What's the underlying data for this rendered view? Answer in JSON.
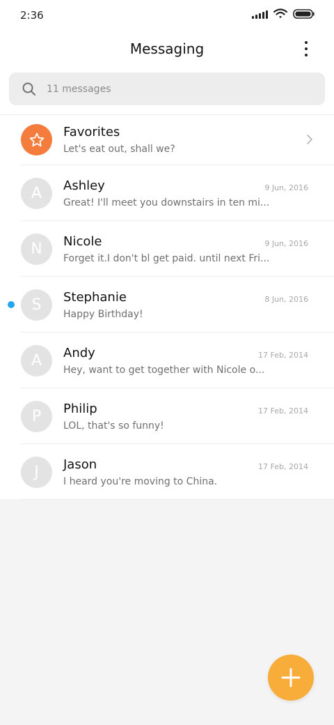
{
  "status_bar": {
    "time": "2:36",
    "icons": [
      "signal-icon",
      "wifi-icon",
      "battery-icon"
    ]
  },
  "header": {
    "title": "Messaging",
    "menu_icon": "more-vertical-icon"
  },
  "search": {
    "placeholder": "11 messages",
    "icon": "search-icon"
  },
  "favorites": {
    "name": "Favorites",
    "preview": "Let's eat out, shall we?",
    "icon": "star-icon",
    "color": "#f47c3c"
  },
  "conversations": [
    {
      "initial": "A",
      "name": "Ashley",
      "preview": "Great! I'll meet you downstairs in ten mi...",
      "date": "9 Jun, 2016",
      "unread": false
    },
    {
      "initial": "N",
      "name": "Nicole",
      "preview": "Forget it.I don't bl get paid. until next Fri...",
      "date": "9 Jun, 2016",
      "unread": false
    },
    {
      "initial": "S",
      "name": "Stephanie",
      "preview": "Happy Birthday!",
      "date": "8 Jun, 2016",
      "unread": true
    },
    {
      "initial": "A",
      "name": "Andy",
      "preview": "Hey, want to get together with Nicole o...",
      "date": "17 Feb, 2014",
      "unread": false
    },
    {
      "initial": "P",
      "name": "Philip",
      "preview": "LOL, that's so funny!",
      "date": "17 Feb, 2014",
      "unread": false
    },
    {
      "initial": "J",
      "name": "Jason",
      "preview": "I heard you're moving to China.",
      "date": "17 Feb, 2014",
      "unread": false
    }
  ],
  "fab": {
    "icon": "plus-icon",
    "color": "#f8ac3a"
  },
  "colors": {
    "unread_dot": "#22a7ee",
    "avatar_bg": "#e3e3e3",
    "background": "#f4f4f4"
  }
}
